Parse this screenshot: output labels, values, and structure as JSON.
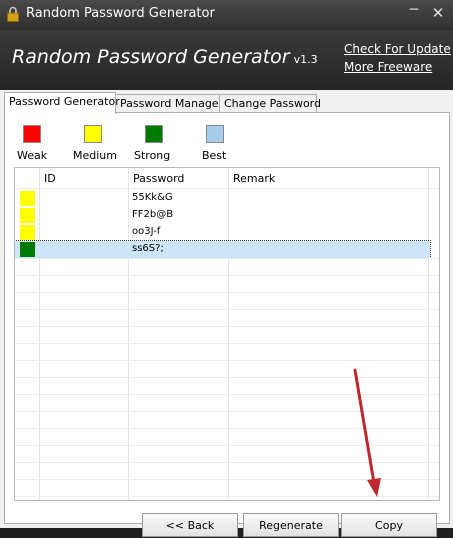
{
  "window": {
    "title": "Random Password Generator",
    "app_icon": "lock-icon",
    "minimize_glyph": "─",
    "close_glyph": "✕"
  },
  "header": {
    "app_title": "Random Password Generator",
    "version": "v1.3",
    "links": [
      "Check For Update",
      "More Freeware"
    ]
  },
  "tabs": [
    {
      "label": "Password Generator",
      "active": true
    },
    {
      "label": "Password Manager",
      "active": false
    },
    {
      "label": "Change Password",
      "active": false
    }
  ],
  "legend": [
    {
      "label": "Weak",
      "color": "#ff0000"
    },
    {
      "label": "Medium",
      "color": "#ffff00"
    },
    {
      "label": "Strong",
      "color": "#007a00"
    },
    {
      "label": "Best",
      "color": "#a8cdec"
    }
  ],
  "table": {
    "columns": [
      "ID",
      "Password",
      "Remark"
    ],
    "rows": [
      {
        "strength": "Medium",
        "color": "#ffff00",
        "id": "",
        "password": "55Kk&G",
        "remark": "",
        "selected": false
      },
      {
        "strength": "Medium",
        "color": "#ffff00",
        "id": "",
        "password": "FF2b@B",
        "remark": "",
        "selected": false
      },
      {
        "strength": "Medium",
        "color": "#ffff00",
        "id": "",
        "password": "oo3J-f",
        "remark": "",
        "selected": false
      },
      {
        "strength": "Strong",
        "color": "#007a00",
        "id": "",
        "password": "ss6S?;",
        "remark": "",
        "selected": true
      }
    ]
  },
  "buttons": {
    "back": "<< Back",
    "regenerate": "Regenerate",
    "copy": "Copy"
  },
  "colors": {
    "annotation_arrow": "#c0272d"
  }
}
